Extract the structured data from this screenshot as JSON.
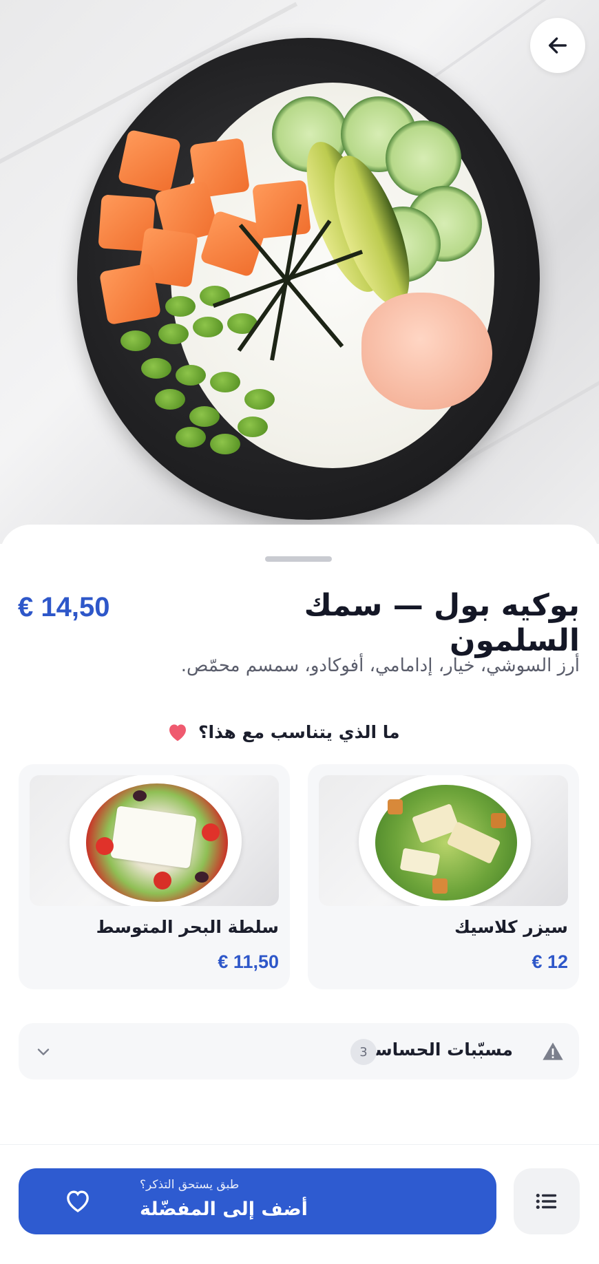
{
  "hero": {
    "image_alt": "poke bowl"
  },
  "header": {
    "back_icon": "arrow-left-icon"
  },
  "dish": {
    "title": "بوكيه بول — سمك السلمون",
    "price": "€ 14,50",
    "description": "أرز السوشي، خيار، إدامامي، أفوكادو، سمسم محمّص."
  },
  "pairs": {
    "heading": "ما الذي يتناسب مع هذا؟",
    "items": [
      {
        "name": "سيزر كلاسيك",
        "price": "€ 12"
      },
      {
        "name": "سلطة البحر المتوسط",
        "price": "€ 11,50"
      }
    ]
  },
  "allergens": {
    "label": "مسبّبات الحساسية",
    "count": "3"
  },
  "bottom": {
    "favorite_sub": "طبق يستحق التذكر؟",
    "favorite_main": "أضف إلى المفضّلة"
  },
  "colors": {
    "accent": "#2e5bd0",
    "price": "#2e57c9",
    "heart": "#ef5a6f"
  }
}
